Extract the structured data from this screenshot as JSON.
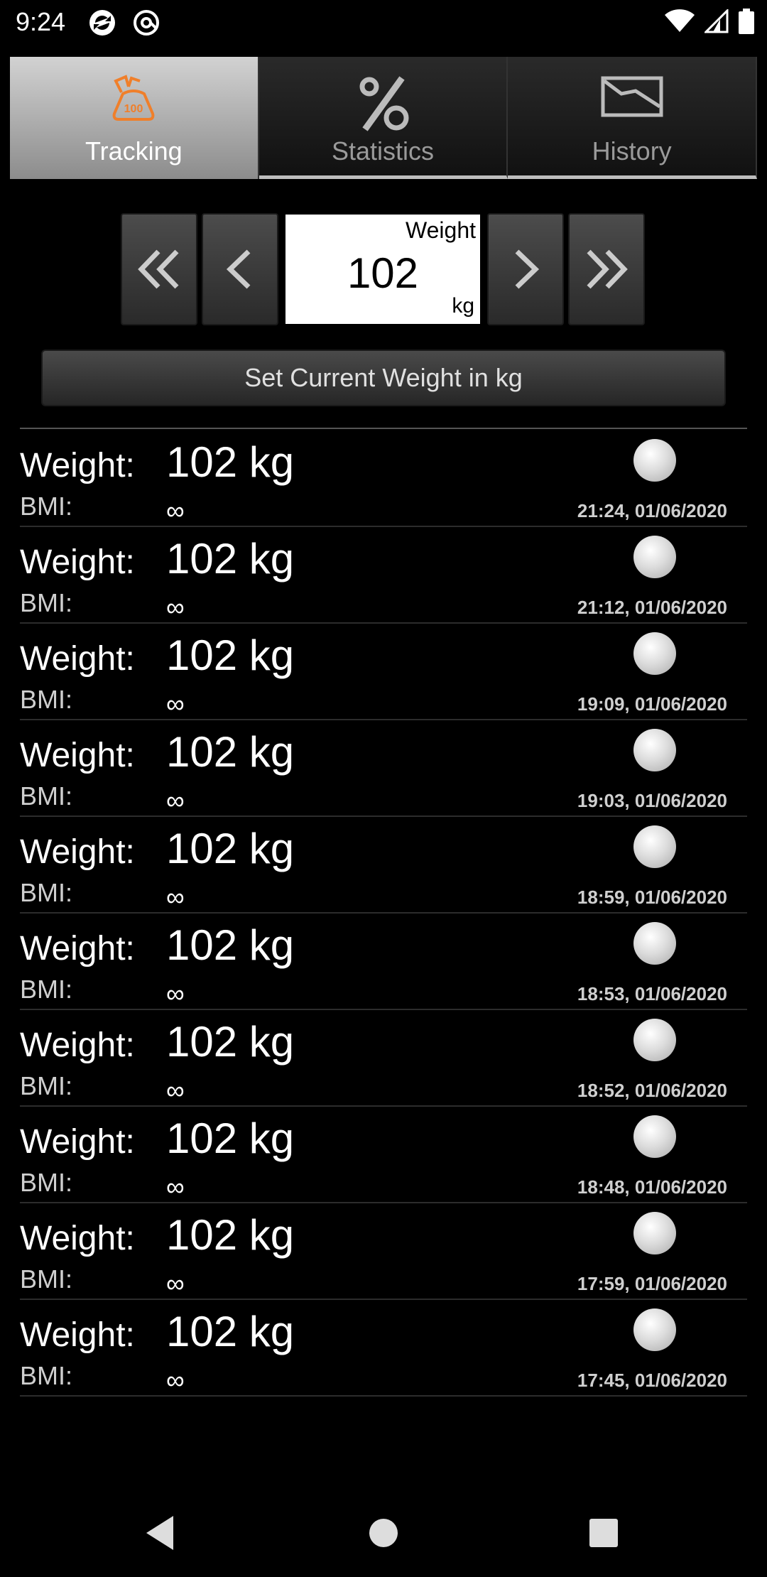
{
  "status_bar": {
    "time": "9:24",
    "icons": [
      "sync-app-icon",
      "at-sign-app-icon",
      "wifi-icon",
      "signal-icon",
      "battery-icon"
    ]
  },
  "tabs": [
    {
      "label": "Tracking",
      "icon": "scale-weight-icon",
      "active": true
    },
    {
      "label": "Statistics",
      "icon": "percent-icon",
      "active": false
    },
    {
      "label": "History",
      "icon": "chart-history-icon",
      "active": false
    }
  ],
  "stepper": {
    "weight_label": "Weight",
    "weight_value": "102",
    "weight_unit": "kg"
  },
  "set_weight_button": "Set Current Weight in kg",
  "entries": [
    {
      "weight_label": "Weight:",
      "weight": "102 kg",
      "bmi_label": "BMI:",
      "bmi": "∞",
      "timestamp": "21:24, 01/06/2020"
    },
    {
      "weight_label": "Weight:",
      "weight": "102 kg",
      "bmi_label": "BMI:",
      "bmi": "∞",
      "timestamp": "21:12, 01/06/2020"
    },
    {
      "weight_label": "Weight:",
      "weight": "102 kg",
      "bmi_label": "BMI:",
      "bmi": "∞",
      "timestamp": "19:09, 01/06/2020"
    },
    {
      "weight_label": "Weight:",
      "weight": "102 kg",
      "bmi_label": "BMI:",
      "bmi": "∞",
      "timestamp": "19:03, 01/06/2020"
    },
    {
      "weight_label": "Weight:",
      "weight": "102 kg",
      "bmi_label": "BMI:",
      "bmi": "∞",
      "timestamp": "18:59, 01/06/2020"
    },
    {
      "weight_label": "Weight:",
      "weight": "102 kg",
      "bmi_label": "BMI:",
      "bmi": "∞",
      "timestamp": "18:53, 01/06/2020"
    },
    {
      "weight_label": "Weight:",
      "weight": "102 kg",
      "bmi_label": "BMI:",
      "bmi": "∞",
      "timestamp": "18:52, 01/06/2020"
    },
    {
      "weight_label": "Weight:",
      "weight": "102 kg",
      "bmi_label": "BMI:",
      "bmi": "∞",
      "timestamp": "18:48, 01/06/2020"
    },
    {
      "weight_label": "Weight:",
      "weight": "102 kg",
      "bmi_label": "BMI:",
      "bmi": "∞",
      "timestamp": "17:59, 01/06/2020"
    },
    {
      "weight_label": "Weight:",
      "weight": "102 kg",
      "bmi_label": "BMI:",
      "bmi": "∞",
      "timestamp": "17:45, 01/06/2020"
    }
  ],
  "colors": {
    "accent": "#f07f2a",
    "background": "#000000"
  }
}
